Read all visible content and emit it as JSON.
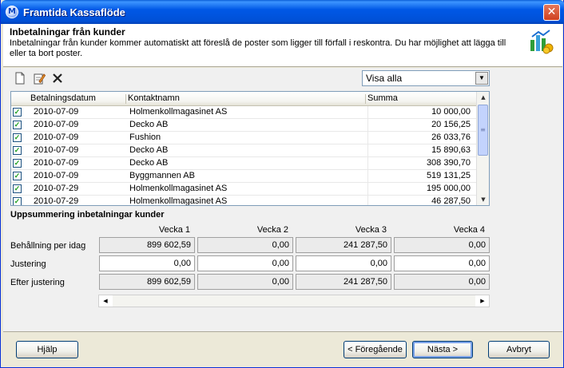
{
  "window": {
    "title": "Framtida Kassaflöde",
    "close_glyph": "✕"
  },
  "header": {
    "title": "Inbetalningar från kunder",
    "description": "Inbetalningar från kunder kommer automatiskt att föreslå de poster som ligger till förfall i reskontra. Du har möjlighet att lägga till eller ta bort poster."
  },
  "toolbar": {
    "icons": [
      "new-document-icon",
      "edit-icon",
      "delete-icon"
    ],
    "filter_value": "Visa alla"
  },
  "table": {
    "columns": [
      "Betalningsdatum",
      "Kontaktnamn",
      "Summa"
    ],
    "rows": [
      {
        "date": "2010-07-09",
        "name": "Holmenkollmagasinet AS",
        "sum": "10 000,00"
      },
      {
        "date": "2010-07-09",
        "name": "Decko AB",
        "sum": "20 156,25"
      },
      {
        "date": "2010-07-09",
        "name": "Fushion",
        "sum": "26 033,76"
      },
      {
        "date": "2010-07-09",
        "name": "Decko AB",
        "sum": "15 890,63"
      },
      {
        "date": "2010-07-09",
        "name": "Decko AB",
        "sum": "308 390,70"
      },
      {
        "date": "2010-07-09",
        "name": "Byggmannen AB",
        "sum": "519 131,25"
      },
      {
        "date": "2010-07-29",
        "name": "Holmenkollmagasinet AS",
        "sum": "195 000,00"
      },
      {
        "date": "2010-07-29",
        "name": "Holmenkollmagasinet AS",
        "sum": "46 287,50"
      }
    ]
  },
  "summary": {
    "title": "Uppsummering inbetalningar kunder",
    "weeks": [
      "Vecka 1",
      "Vecka 2",
      "Vecka 3",
      "Vecka 4"
    ],
    "rows": [
      {
        "label": "Behållning per idag",
        "values": [
          "899 602,59",
          "0,00",
          "241 287,50",
          "0,00"
        ]
      },
      {
        "label": "Justering",
        "values": [
          "0,00",
          "0,00",
          "0,00",
          "0,00"
        ]
      },
      {
        "label": "Efter justering",
        "values": [
          "899 602,59",
          "0,00",
          "241 287,50",
          "0,00"
        ]
      }
    ]
  },
  "footer": {
    "help": "Hjälp",
    "prev": "< Föregående",
    "next": "Nästa >",
    "cancel": "Avbryt"
  }
}
